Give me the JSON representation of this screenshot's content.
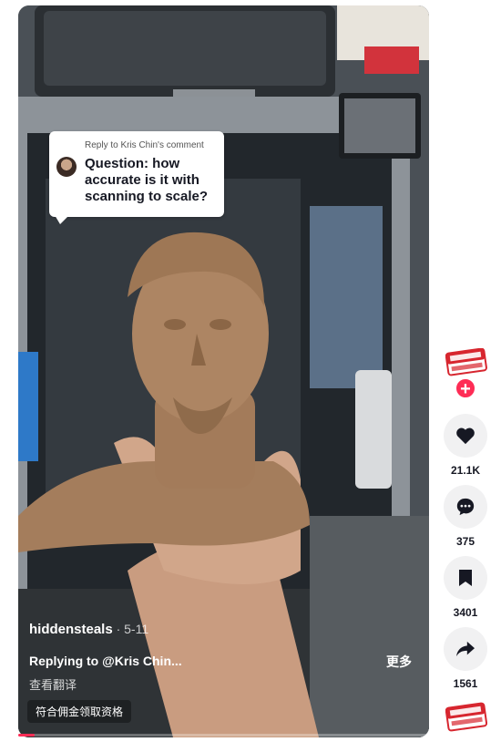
{
  "video": {
    "comment_sticker": {
      "reply_to": "Reply to Kris Chin's comment",
      "question": "Question: how accurate is it with scanning to scale?"
    },
    "username": "hiddensteals",
    "date": " · 5-11",
    "caption": "Replying to @Kris Chin...",
    "more_label": "更多",
    "translate_label": "查看翻译",
    "eligible_label": "符合佣金领取资格",
    "progress": 0.04
  },
  "actions": {
    "avatar_badge_text": "HIDDEN STEALS",
    "follow_symbol": "+",
    "like_count": "21.1K",
    "comment_count": "375",
    "save_count": "3401",
    "share_count": "1561"
  },
  "colors": {
    "accent": "#fe2c55",
    "action_bg": "#f1f1f2",
    "text": "#161823"
  }
}
